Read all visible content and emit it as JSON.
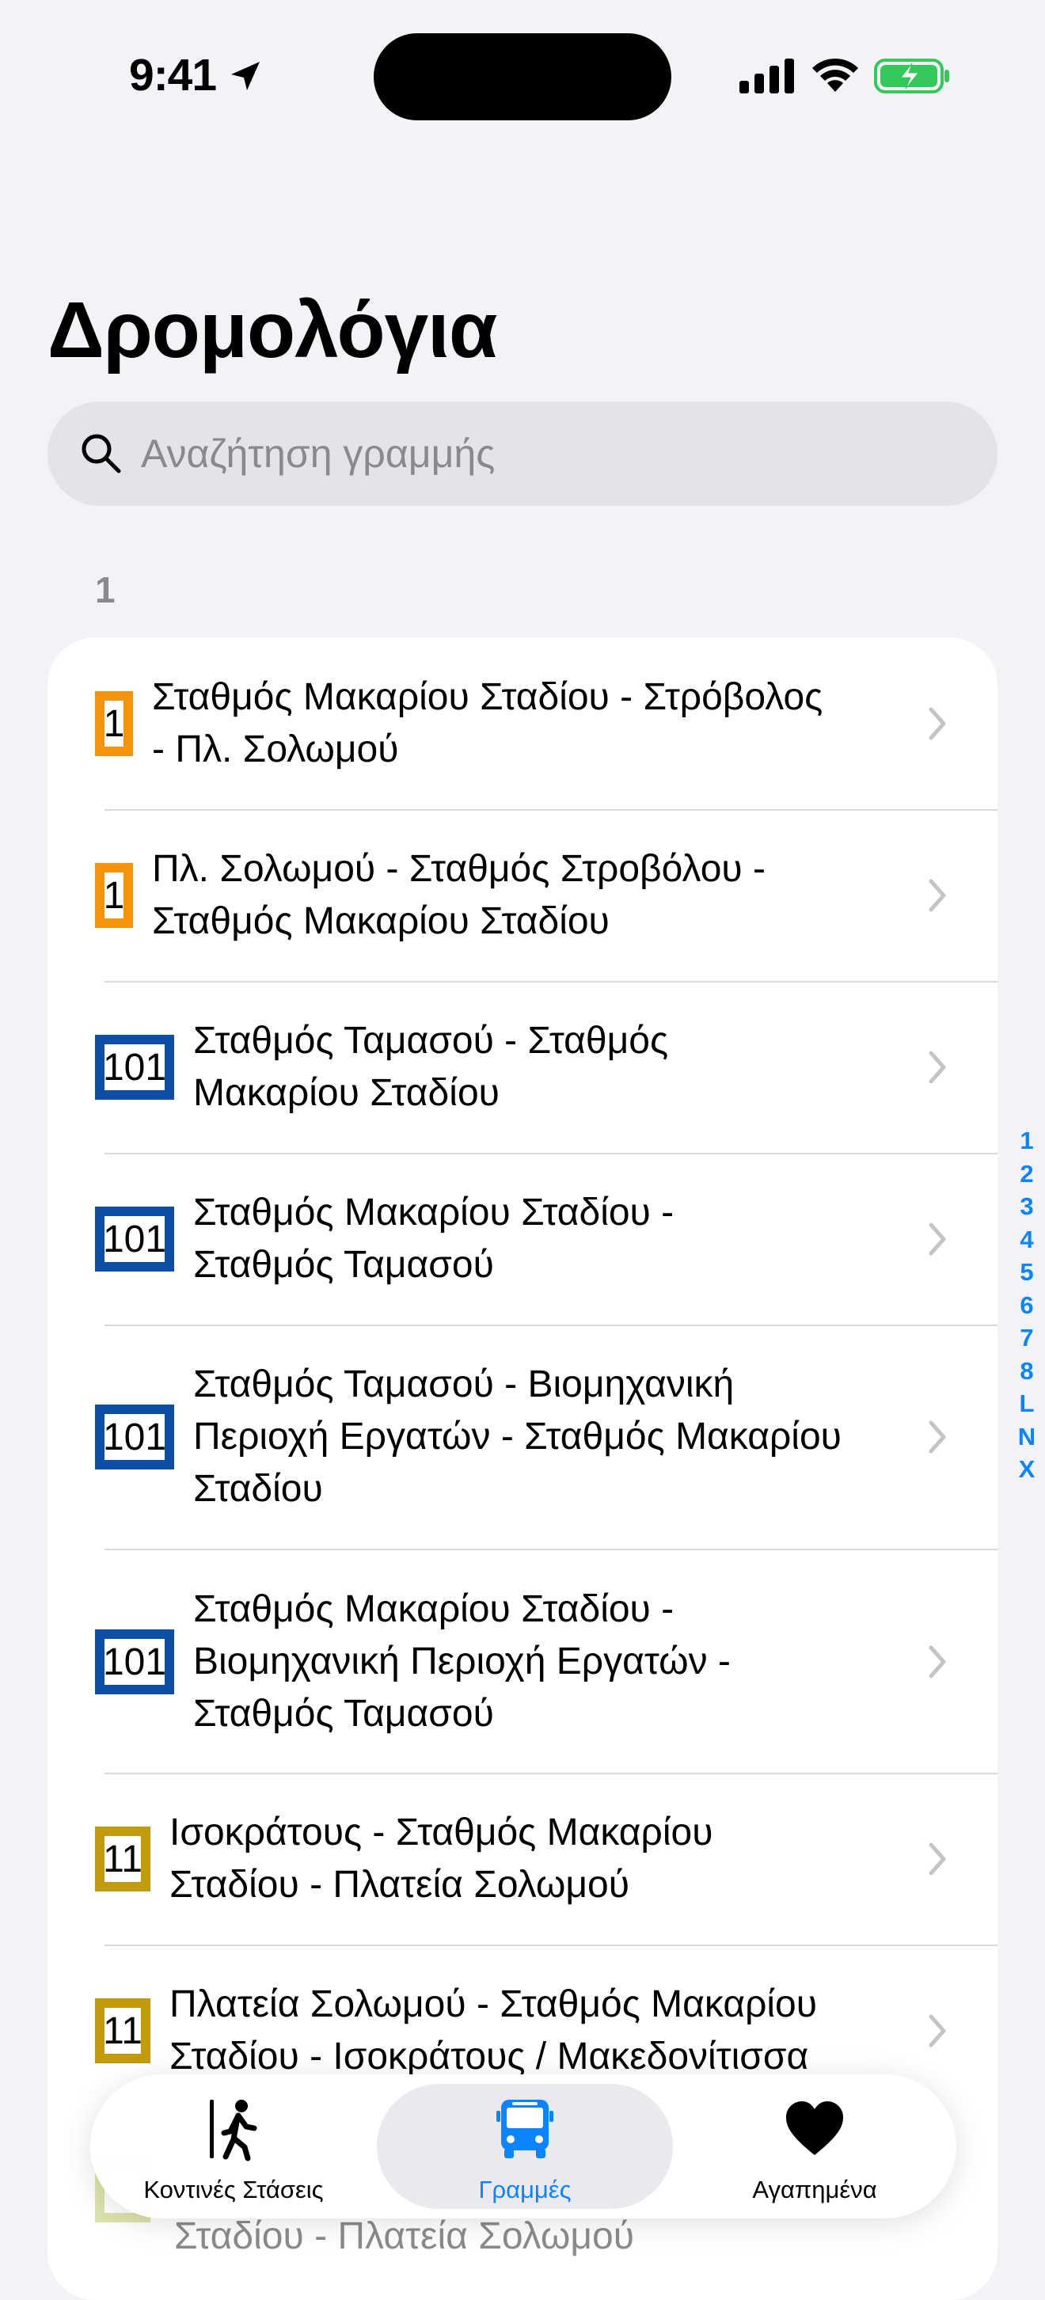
{
  "status": {
    "time": "9:41"
  },
  "page": {
    "title": "Δρομολόγια"
  },
  "search": {
    "placeholder": "Αναζήτηση γραμμής"
  },
  "section": {
    "header": "1"
  },
  "routes": [
    {
      "number": "1",
      "color": "#f5930b",
      "line1": "Σταθμός Μακαρίου Σταδίου - Στρόβολος",
      "line2": "- Πλ. Σολωμού"
    },
    {
      "number": "1",
      "color": "#f5930b",
      "line1": "Πλ. Σολωμού - Σταθμός Στροβόλου -",
      "line2": "Σταθμός Μακαρίου Σταδίου"
    },
    {
      "number": "101",
      "color": "#0d4ea6",
      "line1": "Σταθμός Ταμασού - Σταθμός",
      "line2": "Μακαρίου Σταδίου"
    },
    {
      "number": "101",
      "color": "#0d4ea6",
      "line1": "Σταθμός Μακαρίου Σταδίου -",
      "line2": "Σταθμός Ταμασού"
    },
    {
      "number": "101",
      "color": "#0d4ea6",
      "line1": "Σταθμός Ταμασού - Βιομηχανική",
      "line2": "Περιοχή Εργατών - Σταθμός Μακαρίου",
      "line3": "Σταδίου"
    },
    {
      "number": "101",
      "color": "#0d4ea6",
      "line1": "Σταθμός Μακαρίου Σταδίου -",
      "line2": "Βιομηχανική Περιοχή Εργατών -",
      "line3": "Σταθμός Ταμασού"
    },
    {
      "number": "11",
      "color": "#c39a0b",
      "line1": "Ισοκράτους - Σταθμός Μακαρίου",
      "line2": "Σταδίου - Πλατεία Σολωμού"
    },
    {
      "number": "11",
      "color": "#c39a0b",
      "line1": "Πλατεία Σολωμού - Σταθμός Μακαρίου",
      "line2": "Σταδίου - Ισοκράτους / Μακεδονίτισσα"
    }
  ],
  "ghost_row": {
    "line": "Σταδίου - Πλατεία Σολωμού",
    "color": "#b5bf4a"
  },
  "index": [
    "1",
    "2",
    "3",
    "4",
    "5",
    "6",
    "7",
    "8",
    "L",
    "N",
    "X"
  ],
  "tabs": [
    {
      "label": "Κοντινές Στάσεις",
      "icon": "walking-person-icon",
      "active": false
    },
    {
      "label": "Γραμμές",
      "icon": "bus-icon",
      "active": true
    },
    {
      "label": "Αγαπημένα",
      "icon": "heart-icon",
      "active": false
    }
  ],
  "colors": {
    "accent": "#0a84ff",
    "background": "#f2f2f7",
    "battery": "#34c759"
  }
}
